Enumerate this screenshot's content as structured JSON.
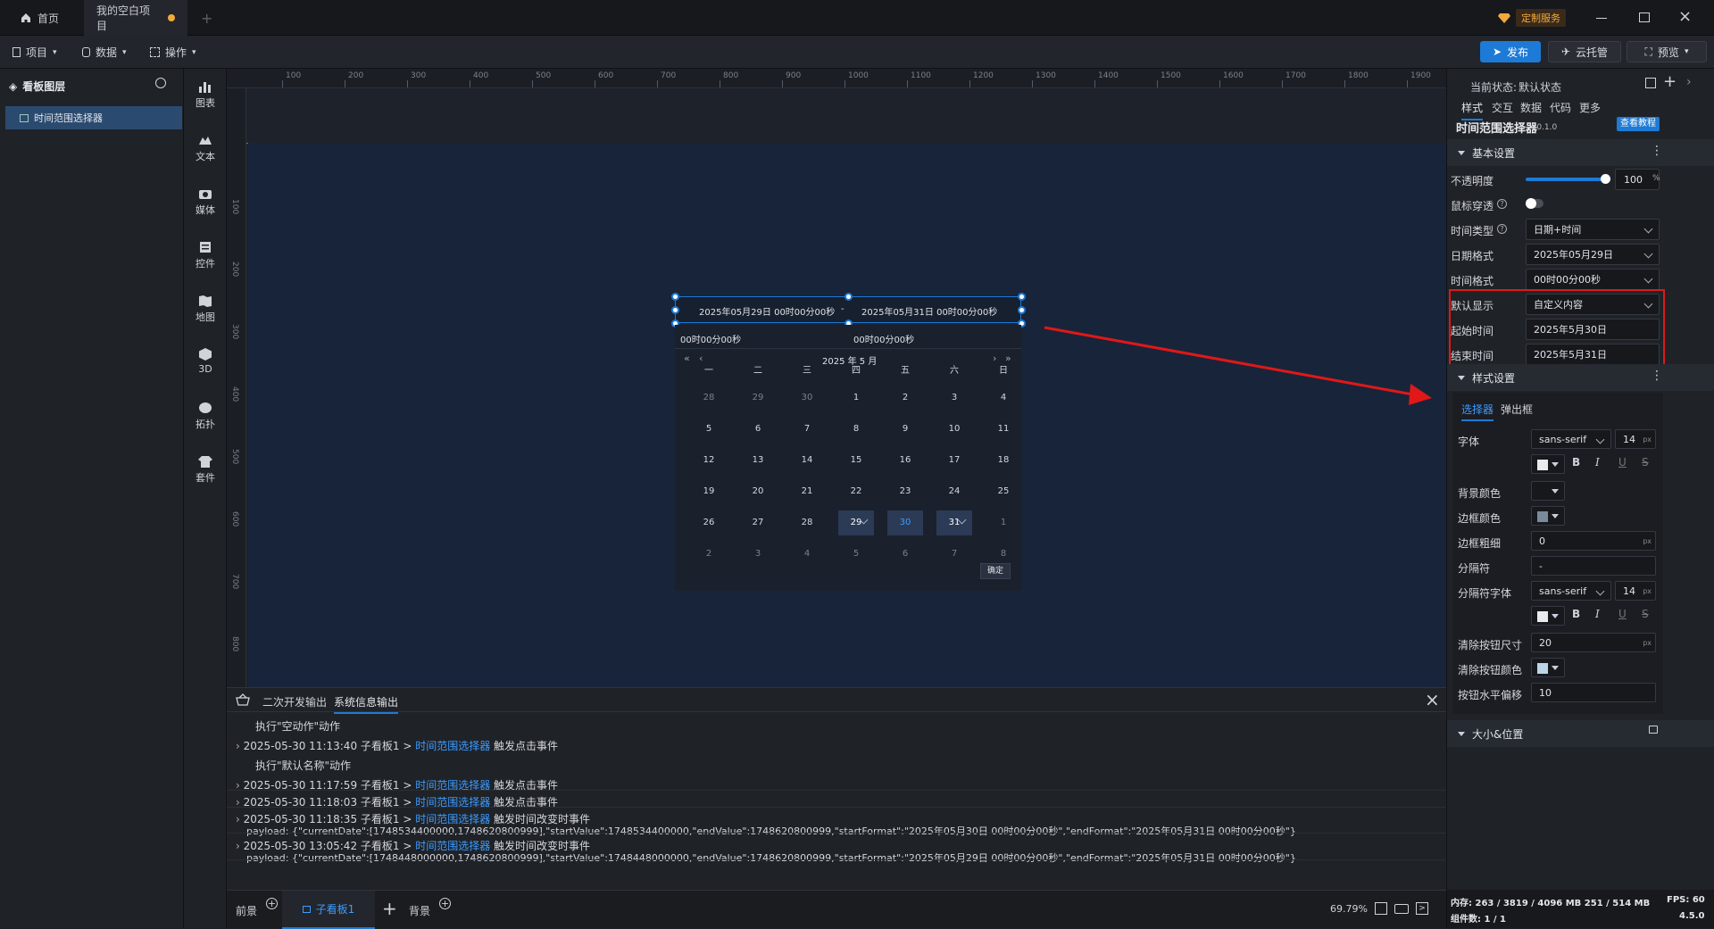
{
  "titlebar": {
    "tabs": [
      {
        "label": "首页"
      },
      {
        "label": "我的空白项目"
      }
    ],
    "custom_service": "定制服务"
  },
  "menubar": {
    "menus": [
      "项目",
      "数据",
      "操作"
    ],
    "publish": "发布",
    "cloud_host": "云托管",
    "preview": "预览"
  },
  "layers": {
    "title": "看板图层",
    "items": [
      "时间范围选择器"
    ]
  },
  "toolbar": {
    "tools": [
      "图表",
      "文本",
      "媒体",
      "控件",
      "地图",
      "3D",
      "拓扑",
      "套件"
    ]
  },
  "ruler": {
    "top": [
      "100",
      "200",
      "300",
      "400",
      "500",
      "600",
      "700",
      "800",
      "900",
      "1000",
      "1100",
      "1200",
      "1300",
      "1400",
      "1500",
      "1600",
      "1700",
      "1800",
      "1900"
    ],
    "left": [
      "100",
      "200",
      "300",
      "400",
      "500",
      "600",
      "700",
      "800"
    ]
  },
  "datepicker": {
    "start_value": "2025年05月29日 00时00分00秒",
    "separator": "-",
    "end_value": "2025年05月31日 00时00分00秒",
    "start_time": "00时00分00秒",
    "end_time": "00时00分00秒",
    "month_label": "2025 年 5 月",
    "weekdays": [
      "一",
      "二",
      "三",
      "四",
      "五",
      "六",
      "日"
    ],
    "days": [
      [
        "28",
        "29",
        "30",
        "1",
        "2",
        "3",
        "4"
      ],
      [
        "5",
        "6",
        "7",
        "8",
        "9",
        "10",
        "11"
      ],
      [
        "12",
        "13",
        "14",
        "15",
        "16",
        "17",
        "18"
      ],
      [
        "19",
        "20",
        "21",
        "22",
        "23",
        "24",
        "25"
      ],
      [
        "26",
        "27",
        "28",
        "29",
        "30",
        "31",
        "1"
      ],
      [
        "2",
        "3",
        "4",
        "5",
        "6",
        "7",
        "8"
      ]
    ],
    "confirm": "确定"
  },
  "console": {
    "tabs": [
      "二次开发输出",
      "系统信息输出"
    ],
    "lines": [
      {
        "ts": "",
        "text": "执行\"空动作\"动作",
        "link": "",
        "suffix": ""
      },
      {
        "ts": "2025-05-30 11:13:40",
        "text": "子看板1 >",
        "link": "时间范围选择器",
        "suffix": "触发点击事件"
      },
      {
        "ts": "",
        "text": "执行\"默认名称\"动作",
        "link": "",
        "suffix": ""
      },
      {
        "ts": "2025-05-30 11:17:59",
        "text": "子看板1 >",
        "link": "时间范围选择器",
        "suffix": "触发点击事件"
      },
      {
        "ts": "2025-05-30 11:18:03",
        "text": "子看板1 >",
        "link": "时间范围选择器",
        "suffix": "触发点击事件"
      },
      {
        "ts": "2025-05-30 11:18:35",
        "text": "子看板1 >",
        "link": "时间范围选择器",
        "suffix": "触发时间改变时事件"
      },
      {
        "ts": "",
        "text": "payload: {\"currentDate\":[1748534400000,1748620800999],\"startValue\":1748534400000,\"endValue\":1748620800999,\"startFormat\":\"2025年05月30日 00时00分00秒\",\"endFormat\":\"2025年05月31日 00时00分00秒\"}",
        "link": "",
        "suffix": ""
      },
      {
        "ts": "2025-05-30 13:05:42",
        "text": "子看板1 >",
        "link": "时间范围选择器",
        "suffix": "触发时间改变时事件"
      },
      {
        "ts": "",
        "text": "payload: {\"currentDate\":[1748448000000,1748620800999],\"startValue\":1748448000000,\"endValue\":1748620800999,\"startFormat\":\"2025年05月29日 00时00分00秒\",\"endFormat\":\"2025年05月31日 00时00分00秒\"}",
        "link": "",
        "suffix": ""
      }
    ]
  },
  "bottombar": {
    "front": "前景",
    "board": "子看板1",
    "back": "背景",
    "zoom": "69.79%"
  },
  "rightpanel": {
    "state_label": "当前状态:",
    "state_value": "默认状态",
    "tabs": [
      "样式",
      "交互",
      "数据",
      "代码",
      "更多"
    ],
    "component_name": "时间范围选择器",
    "version": "v0.1.0",
    "tutorial": "查看教程",
    "basic_section": "基本设置",
    "opacity_label": "不透明度",
    "opacity_value": "100",
    "opacity_unit": "%",
    "mouse_through_label": "鼠标穿透",
    "time_type_label": "时间类型",
    "time_type_value": "日期+时间",
    "date_format_label": "日期格式",
    "date_format_value": "2025年05月29日",
    "time_format_label": "时间格式",
    "time_format_value": "00时00分00秒",
    "default_display_label": "默认显示",
    "default_display_value": "自定义内容",
    "start_time_label": "起始时间",
    "start_time_value": "2025年5月30日",
    "end_time_label": "结束时间",
    "end_time_value": "2025年5月31日",
    "style_section": "样式设置",
    "style_tabs": [
      "选择器",
      "弹出框"
    ],
    "font_label": "字体",
    "font_value": "sans-serif",
    "font_size": "14",
    "unit_px": "px",
    "bg_color_label": "背景颜色",
    "border_color_label": "边框颜色",
    "border_width_label": "边框粗细",
    "border_width_value": "0",
    "separator_label": "分隔符",
    "separator_value": "-",
    "sep_font_label": "分隔符字体",
    "sep_font_value": "sans-serif",
    "sep_font_size": "14",
    "clear_size_label": "清除按钮尺寸",
    "clear_size_value": "20",
    "clear_color_label": "清除按钮颜色",
    "btn_offset_label": "按钮水平偏移",
    "btn_offset_value": "10",
    "size_pos_section": "大小&位置",
    "status_mem": "内存: 263 / 3819 / 4096 MB 251 / 514 MB",
    "status_fps": "FPS: 60",
    "status_count": "组件数: 1 / 1",
    "status_version": "4.5.0"
  },
  "colors": {
    "accent": "#1d7ad6",
    "link": "#3d9cff",
    "highlight": "#e01818"
  }
}
